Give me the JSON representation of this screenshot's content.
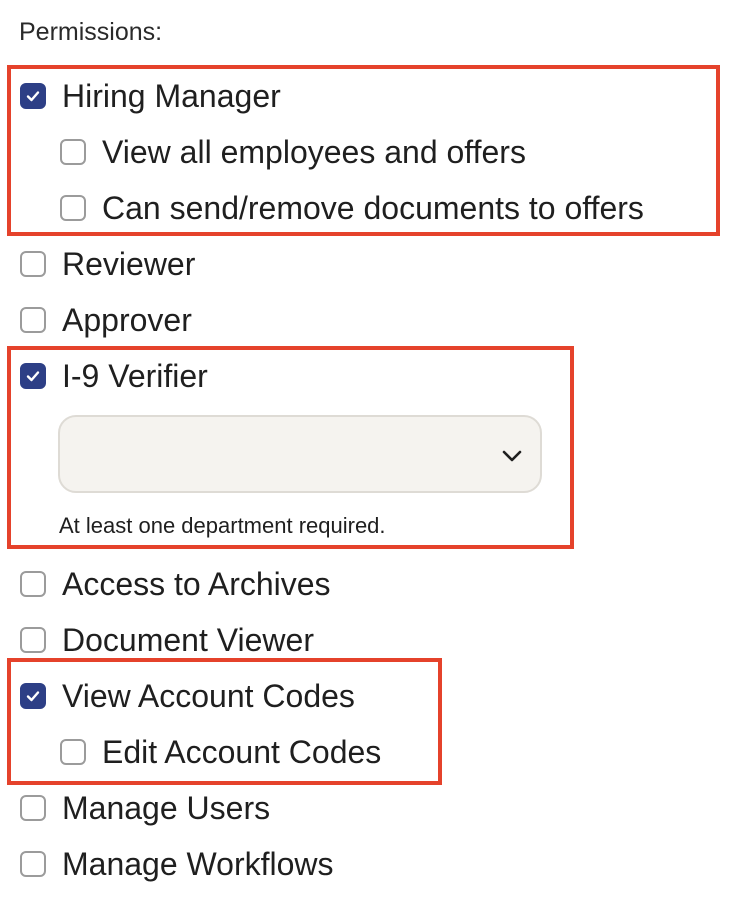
{
  "section": {
    "title": "Permissions:"
  },
  "permissions": [
    {
      "label": "Hiring Manager",
      "checked": true
    },
    {
      "label": "View all employees and offers",
      "checked": false
    },
    {
      "label": "Can send/remove documents to offers",
      "checked": false
    },
    {
      "label": "Reviewer",
      "checked": false
    },
    {
      "label": "Approver",
      "checked": false
    },
    {
      "label": "I-9 Verifier",
      "checked": true
    },
    {
      "label": "Access to Archives",
      "checked": false
    },
    {
      "label": "Document Viewer",
      "checked": false
    },
    {
      "label": "View Account Codes",
      "checked": true
    },
    {
      "label": "Edit Account Codes",
      "checked": false
    },
    {
      "label": "Manage Users",
      "checked": false
    },
    {
      "label": "Manage Workflows",
      "checked": false
    }
  ],
  "department_select": {
    "value": "",
    "icon": "chevron-down-icon"
  },
  "department_help": "At least one department required.",
  "colors": {
    "checked": "#2d3f86",
    "highlight": "#e5422b",
    "select_bg": "#f5f3ef"
  }
}
